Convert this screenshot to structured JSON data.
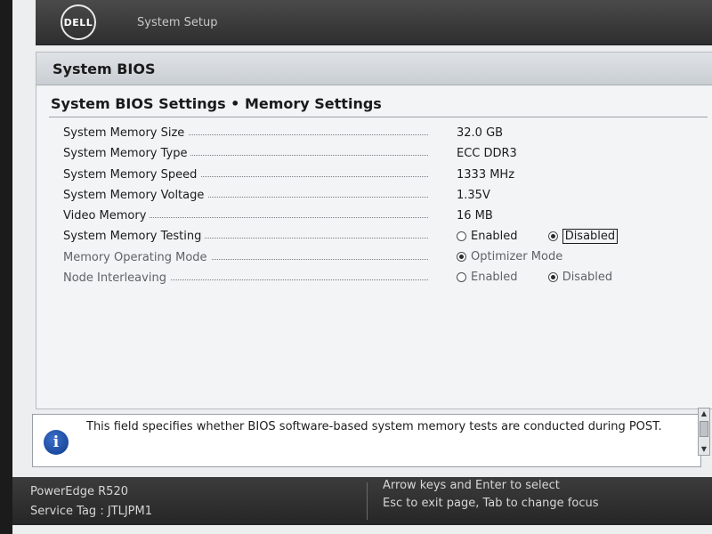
{
  "header": {
    "logo_text": "DELL",
    "app_title": "System Setup"
  },
  "section": {
    "title": "System BIOS",
    "page_heading": "System BIOS Settings • Memory Settings"
  },
  "settings": [
    {
      "label": "System Memory Size",
      "value": "32.0 GB"
    },
    {
      "label": "System Memory Type",
      "value": "ECC DDR3"
    },
    {
      "label": "System Memory Speed",
      "value": "1333 MHz"
    },
    {
      "label": "System Memory Voltage",
      "value": "1.35V"
    },
    {
      "label": "Video Memory",
      "value": "16 MB"
    }
  ],
  "memory_testing": {
    "label": "System Memory Testing",
    "option_enabled": "Enabled",
    "option_disabled": "Disabled",
    "selected": "Disabled"
  },
  "operating_mode": {
    "label": "Memory Operating Mode",
    "option": "Optimizer Mode",
    "selected": "Optimizer Mode"
  },
  "node_interleaving": {
    "label": "Node Interleaving",
    "option_enabled": "Enabled",
    "option_disabled": "Disabled",
    "selected": "Disabled"
  },
  "help": {
    "text": "This field specifies whether BIOS software-based system memory tests are conducted during POST."
  },
  "footer": {
    "model": "PowerEdge R520",
    "service_tag": "Service Tag : JTLJPM1",
    "hint_select": "Arrow keys and Enter to select",
    "hint_exit": "Esc to exit page, Tab to change focus"
  }
}
